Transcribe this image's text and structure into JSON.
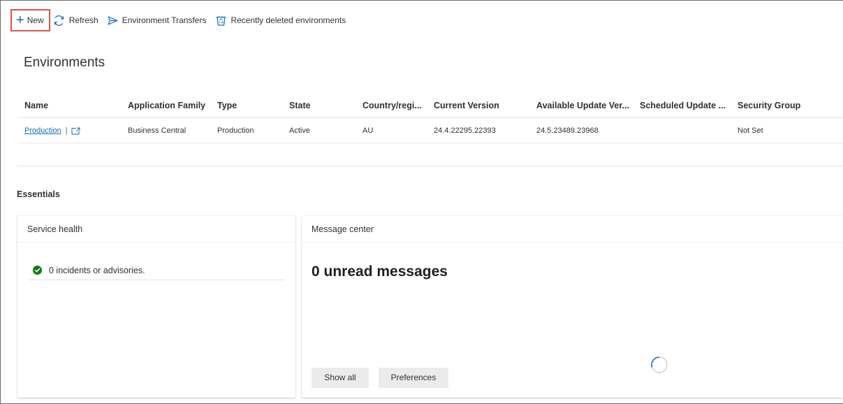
{
  "toolbar": {
    "new_label": "New",
    "refresh_label": "Refresh",
    "transfers_label": "Environment Transfers",
    "deleted_label": "Recently deleted environments"
  },
  "page": {
    "title": "Environments"
  },
  "table": {
    "headers": [
      "Name",
      "Application Family",
      "Type",
      "State",
      "Country/regi...",
      "Current Version",
      "Available Update Ver...",
      "Scheduled Update ...",
      "Security Group"
    ],
    "rows": [
      {
        "name": "Production",
        "separator": "|",
        "application_family": "Business Central",
        "type": "Production",
        "state": "Active",
        "country": "AU",
        "current_version": "24.4.22295.22393",
        "available_update_version": "24.5.23489.23968",
        "scheduled_update": "",
        "security_group": "Not Set"
      }
    ]
  },
  "essentials": {
    "title": "Essentials",
    "service_health": {
      "title": "Service health",
      "status": "0 incidents or advisories.",
      "status_color": "#107c10"
    },
    "message_center": {
      "title": "Message center",
      "unread": "0 unread messages",
      "show_all_label": "Show all",
      "preferences_label": "Preferences"
    }
  },
  "colors": {
    "accent": "#0f6cbd",
    "highlight_box": "#e0524e",
    "success": "#107c10"
  }
}
